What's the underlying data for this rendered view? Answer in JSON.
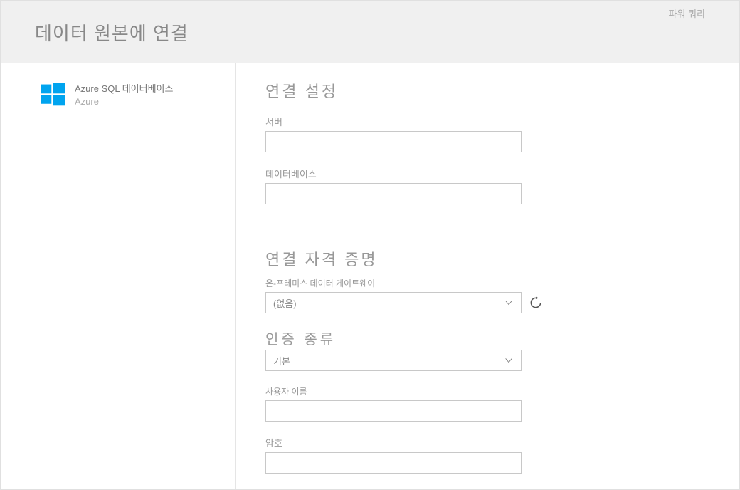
{
  "brand": "파워 쿼리",
  "header": {
    "title": "데이터 원본에 연결"
  },
  "sidebar": {
    "datasource": {
      "title": "Azure SQL 데이터베이스",
      "subtitle": "Azure"
    }
  },
  "main": {
    "section1_heading": "연결 설정",
    "server_label": "서버",
    "server_value": "",
    "database_label": "데이터베이스",
    "database_value": "",
    "section2_heading": "연결 자격 증명",
    "gateway_label": "온-프레미스 데이터 게이트웨이",
    "gateway_value": "(없음)",
    "auth_heading": "인증 종류",
    "auth_value": "기본",
    "username_label": "사용자 이름",
    "username_value": "",
    "password_label": "암호",
    "password_value": ""
  }
}
